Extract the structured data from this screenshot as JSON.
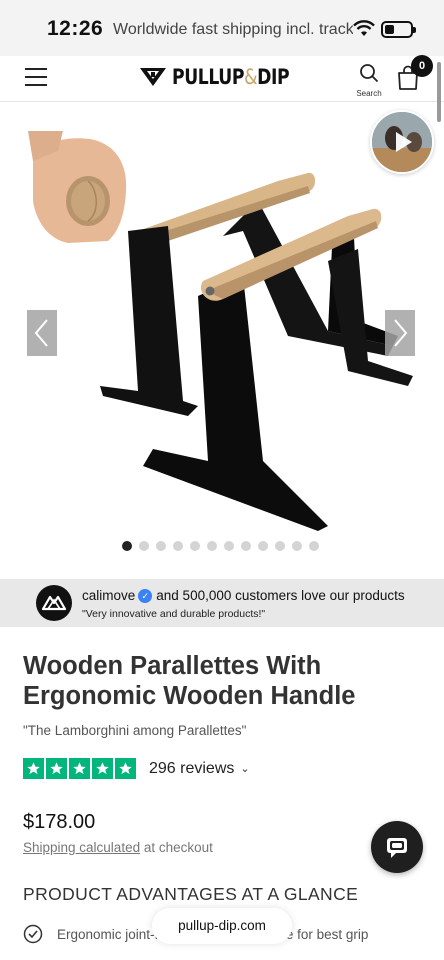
{
  "status_bar": {
    "time": "12:26",
    "ticker": "Worldwide fast shipping incl. tracki"
  },
  "header": {
    "logo_text_main": "PULLUP",
    "logo_text_amp": "&",
    "logo_text_end": "DIP",
    "search_label": "Search",
    "cart_count": "0"
  },
  "gallery": {
    "image_count": 12,
    "active_index": 0
  },
  "proof_banner": {
    "brand": "calimove",
    "message": "and 500,000 customers love our products",
    "quote": "\"Very innovative and durable products!\""
  },
  "product": {
    "title": "Wooden Parallettes With Ergonomic Wooden Handle",
    "subtitle": "\"The Lamborghini among Parallettes\"",
    "rating_stars": 5,
    "reviews_label": "296 reviews",
    "price": "$178.00",
    "shipping_link": "Shipping calculated",
    "shipping_rest": " at checkout"
  },
  "advantages": {
    "heading": "PRODUCT ADVANTAGES AT A GLANCE",
    "items": [
      "Ergonomic joint-friendly wooden handle for best grip"
    ]
  },
  "browser": {
    "url": "pullup-dip.com"
  },
  "colors": {
    "trustpilot_green": "#00b67a",
    "brand_gold": "#c8a56a",
    "verified_blue": "#3b82f6"
  }
}
